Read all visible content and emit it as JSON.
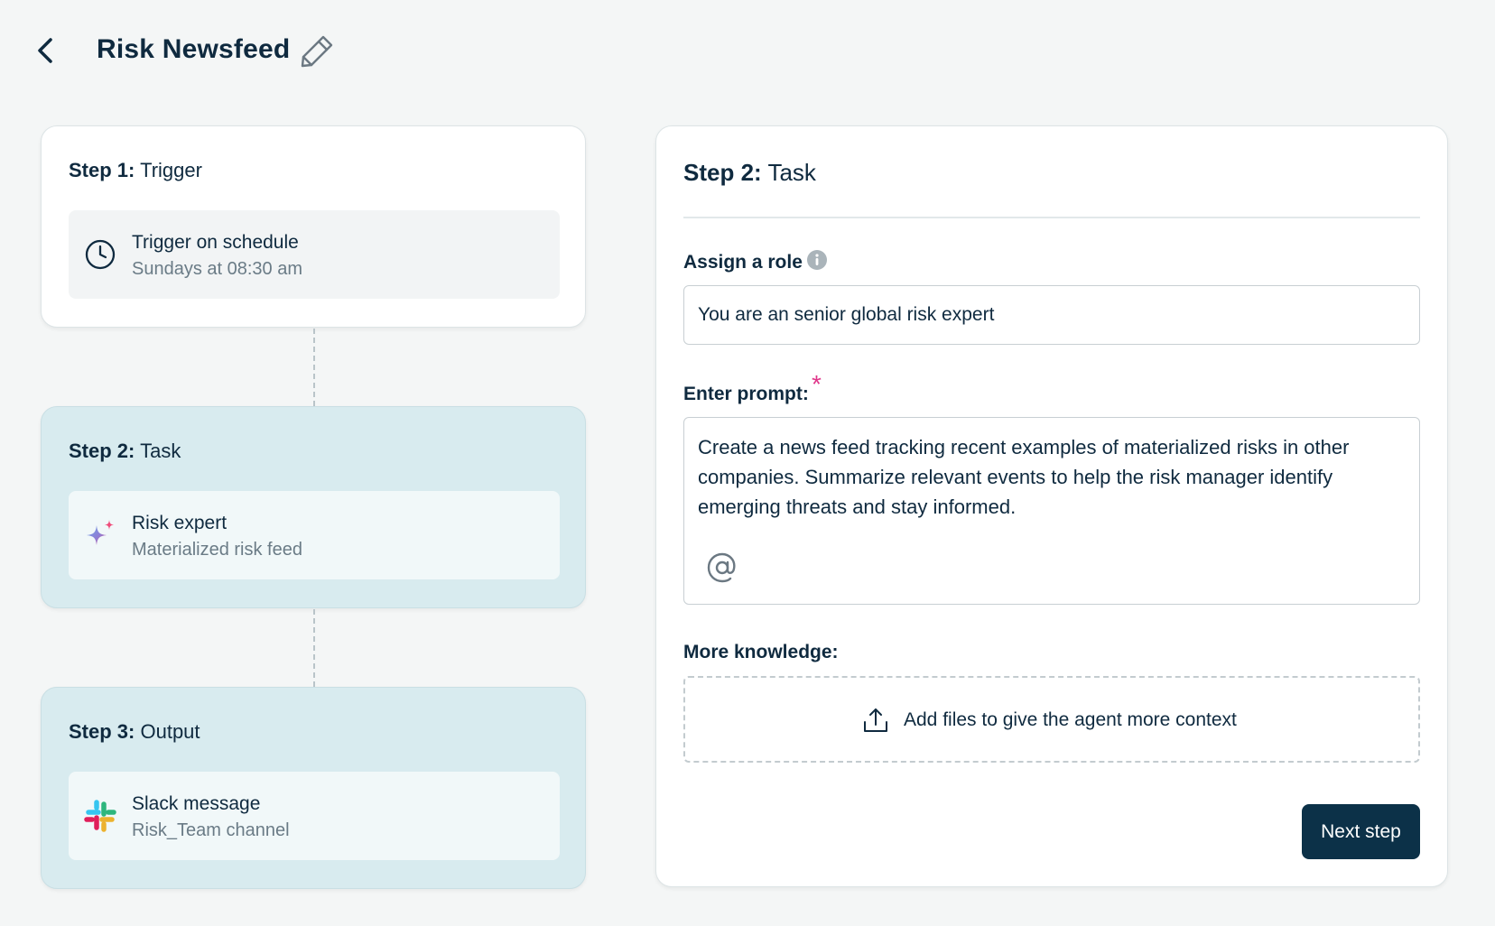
{
  "header": {
    "title": "Risk Newsfeed",
    "back_icon": "chevron-left-icon",
    "edit_icon": "pencil-icon"
  },
  "steps": [
    {
      "label": "Step 1:",
      "name": "Trigger",
      "item_title": "Trigger on schedule",
      "item_subtitle": "Sundays at 08:30 am",
      "icon": "clock-icon"
    },
    {
      "label": "Step 2:",
      "name": "Task",
      "item_title": "Risk expert",
      "item_subtitle": "Materialized risk feed",
      "icon": "sparkle-icon"
    },
    {
      "label": "Step 3:",
      "name": "Output",
      "item_title": "Slack message",
      "item_subtitle": "Risk_Team channel",
      "icon": "slack-icon"
    }
  ],
  "panel": {
    "title_label": "Step 2:",
    "title_name": "Task",
    "role_label": "Assign a role",
    "role_value": "You are an senior global risk expert",
    "prompt_label": "Enter prompt:",
    "required_mark": "*",
    "prompt_value": "Create a news feed tracking recent examples of materialized risks in other companies. Summarize relevant events to help the risk manager identify emerging threats and stay informed.",
    "knowledge_label": "More knowledge:",
    "upload_text": "Add files to give the agent more context",
    "next_button": "Next step"
  },
  "colors": {
    "background": "#f4f6f6",
    "primary_text": "#0f2a3f",
    "tinted_card": "#d8ebef",
    "button": "#0c3148",
    "required": "#e0368a"
  }
}
